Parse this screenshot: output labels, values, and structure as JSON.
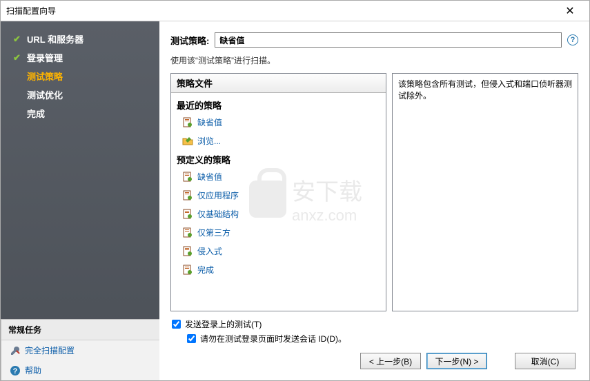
{
  "titlebar": {
    "title": "扫描配置向导"
  },
  "sidebar": {
    "nav": [
      {
        "label": "URL 和服务器",
        "done": true,
        "active": false
      },
      {
        "label": "登录管理",
        "done": true,
        "active": false
      },
      {
        "label": "测试策略",
        "done": false,
        "active": true
      },
      {
        "label": "测试优化",
        "done": false,
        "active": false
      },
      {
        "label": "完成",
        "done": false,
        "active": false
      }
    ],
    "tasks_header": "常规任务",
    "tasks": [
      {
        "label": "完全扫描配置",
        "icon": "wrench"
      },
      {
        "label": "帮助",
        "icon": "help"
      }
    ]
  },
  "main": {
    "policy_label": "测试策略:",
    "policy_value": "缺省值",
    "hint": "使用该“测试策略”进行扫描。",
    "tree_header": "策略文件",
    "groups": [
      {
        "title": "最近的策略",
        "items": [
          {
            "label": "缺省值",
            "icon": "page"
          },
          {
            "label": "浏览...",
            "icon": "folder"
          }
        ]
      },
      {
        "title": "预定义的策略",
        "items": [
          {
            "label": "缺省值",
            "icon": "page"
          },
          {
            "label": "仅应用程序",
            "icon": "page"
          },
          {
            "label": "仅基础结构",
            "icon": "page"
          },
          {
            "label": "仅第三方",
            "icon": "page"
          },
          {
            "label": "侵入式",
            "icon": "page"
          },
          {
            "label": "完成",
            "icon": "page"
          }
        ]
      }
    ],
    "description": "该策略包含所有测试，但侵入式和端口侦听器测试除外。",
    "check1": "发送登录上的测试(T)",
    "check2": "请勿在测试登录页面时发送会话 ID(D)。"
  },
  "footer": {
    "back": "< 上一步(B)",
    "next": "下一步(N) >",
    "cancel": "取消(C)"
  },
  "watermark": {
    "text1": "安下载",
    "text2": "anxz.com"
  }
}
